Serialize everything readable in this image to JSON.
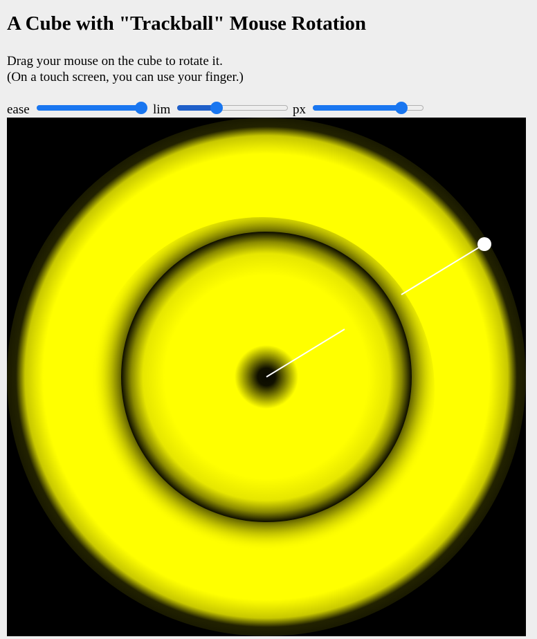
{
  "page": {
    "title": "A Cube with \"Trackball\" Mouse Rotation",
    "intro_line1": "Drag your mouse on the cube to rotate it.",
    "intro_line2": "(On a touch screen, you can use your finger.)"
  },
  "controls": {
    "ease": {
      "label": "ease",
      "value_fraction": 1.0
    },
    "lim": {
      "label": "lim",
      "value_fraction": 0.34
    },
    "px": {
      "label": "px",
      "value_fraction": 0.84
    }
  },
  "colors": {
    "page_bg": "#eeeeee",
    "slider_accent": "#1976f0",
    "canvas_bg": "#000000",
    "ring_color": "#ffff00",
    "handle_color": "#ffffff"
  }
}
